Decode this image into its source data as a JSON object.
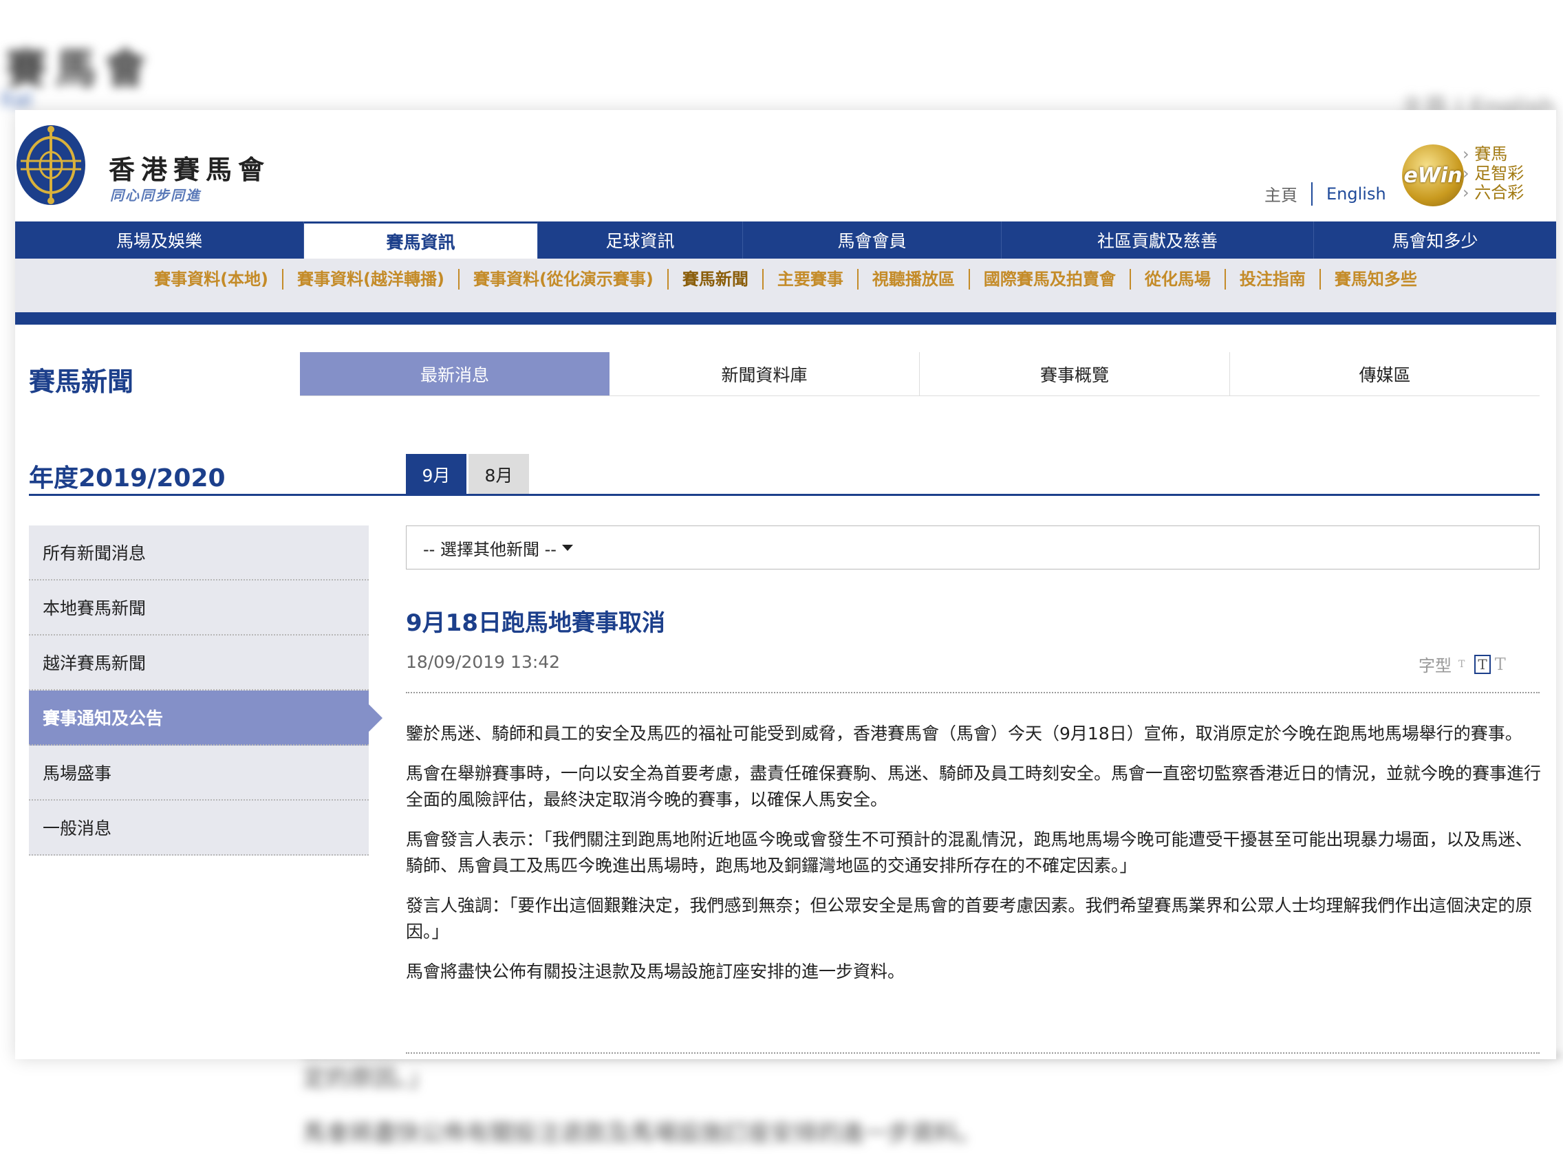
{
  "header": {
    "brand_name": "香港賽馬會",
    "brand_slogan": "同心同步同進",
    "home_link": "主頁",
    "english_link": "English",
    "ewin_label": "eWin",
    "ewin_links": [
      "賽馬",
      "足智彩",
      "六合彩"
    ]
  },
  "main_nav": [
    {
      "label": "馬場及娛樂",
      "active": false
    },
    {
      "label": "賽馬資訊",
      "active": true
    },
    {
      "label": "足球資訊",
      "active": false
    },
    {
      "label": "馬會會員",
      "active": false
    },
    {
      "label": "社區貢獻及慈善",
      "active": false
    },
    {
      "label": "馬會知多少",
      "active": false
    }
  ],
  "sub_nav": [
    {
      "label": "賽事資料(本地)",
      "active": false
    },
    {
      "label": "賽事資料(越洋轉播)",
      "active": false
    },
    {
      "label": "賽事資料(從化演示賽事)",
      "active": false
    },
    {
      "label": "賽馬新聞",
      "active": true
    },
    {
      "label": "主要賽事",
      "active": false
    },
    {
      "label": "視聽播放區",
      "active": false
    },
    {
      "label": "國際賽馬及拍賣會",
      "active": false
    },
    {
      "label": "從化馬場",
      "active": false
    },
    {
      "label": "投注指南",
      "active": false
    },
    {
      "label": "賽馬知多些",
      "active": false
    }
  ],
  "page": {
    "title": "賽馬新聞",
    "tabs": [
      {
        "label": "最新消息",
        "active": true
      },
      {
        "label": "新聞資料庫",
        "active": false
      },
      {
        "label": "賽事概覽",
        "active": false
      },
      {
        "label": "傳媒區",
        "active": false
      }
    ],
    "year_title": "年度2019/2020",
    "months": [
      {
        "label": "9月",
        "active": true
      },
      {
        "label": "8月",
        "active": false
      }
    ]
  },
  "sidebar": [
    {
      "label": "所有新聞消息",
      "active": false
    },
    {
      "label": "本地賽馬新聞",
      "active": false
    },
    {
      "label": "越洋賽馬新聞",
      "active": false
    },
    {
      "label": "賽事通知及公告",
      "active": true
    },
    {
      "label": "馬場盛事",
      "active": false
    },
    {
      "label": "一般消息",
      "active": false
    }
  ],
  "content": {
    "dropdown_value": "-- 選擇其他新聞 --",
    "article_title": "9月18日跑馬地賽事取消",
    "article_date": "18/09/2019 13:42",
    "font_size_label": "字型",
    "paragraphs": [
      "鑒於馬迷、騎師和員工的安全及馬匹的福祉可能受到威脅，香港賽馬會（馬會）今天（9月18日）宣佈，取消原定於今晚在跑馬地馬場舉行的賽事。",
      "馬會在舉辦賽事時，一向以安全為首要考慮，盡責任確保賽駒、馬迷、騎師及員工時刻安全。馬會一直密切監察香港近日的情況，並就今晚的賽事進行全面的風險評估，最終決定取消今晚的賽事，以確保人馬安全。",
      "馬會發言人表示：「我們關注到跑馬地附近地區今晚或會發生不可預計的混亂情況，跑馬地馬場今晚可能遭受干擾甚至可能出現暴力場面，以及馬迷、騎師、馬會員工及馬匹今晚進出馬場時，跑馬地及銅鑼灣地區的交通安排所存在的不確定因素。」",
      "發言人強調：「要作出這個艱難決定，我們感到無奈；但公眾安全是馬會的首要考慮因素。我們希望賽馬業界和公眾人士均理解我們作出這個決定的原因。」",
      "馬會將盡快公佈有關投注退款及馬場設施訂座安排的進一步資料。"
    ]
  },
  "background": {
    "blurred_title": "賽馬會",
    "blurred_sub": "Ital",
    "blurred_lang": "主頁 | English",
    "blurred_line1": "定的原因。」",
    "blurred_line2": "馬會將盡快公佈有關投注退款及馬場設施訂座安排的進一步資料。"
  },
  "colors": {
    "brand_blue": "#1c3f8b",
    "accent_purple": "#8490c8",
    "gold": "#c48b28",
    "subnav_bg": "#e7e8ee"
  }
}
